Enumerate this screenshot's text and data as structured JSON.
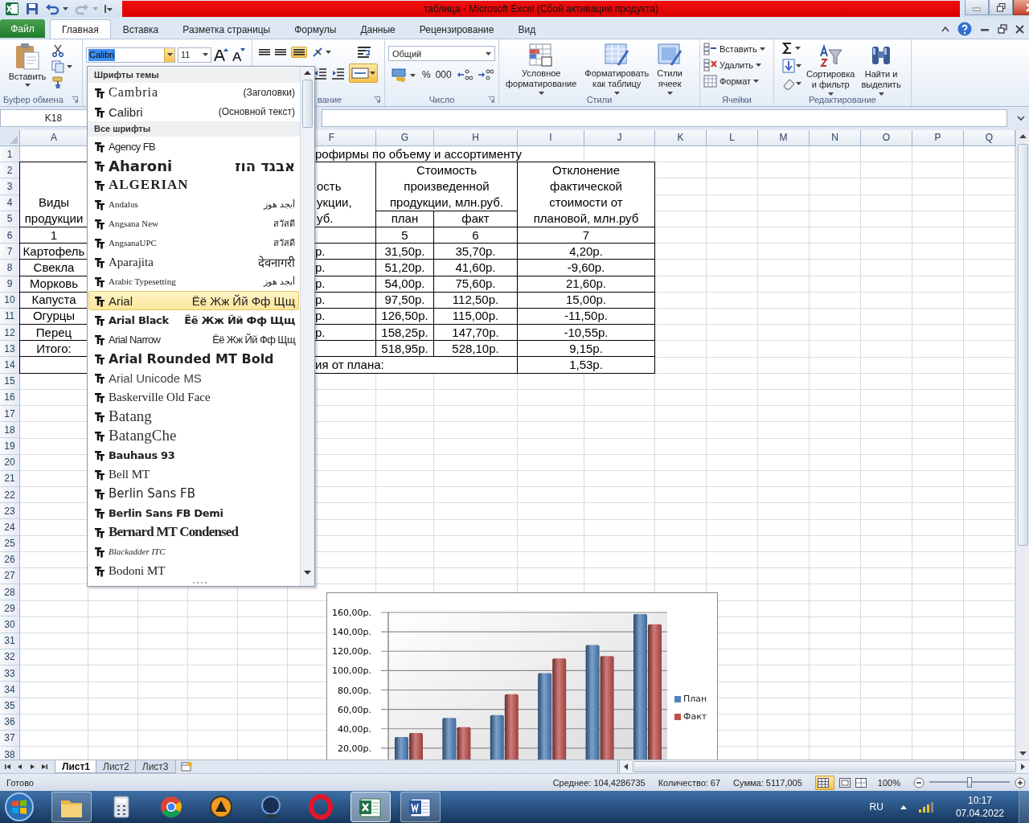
{
  "window": {
    "title": "таблица  -  Microsoft Excel (Сбой активации продукта)"
  },
  "ribbon_tabs": [
    {
      "label": "Файл",
      "kind": "file"
    },
    {
      "label": "Главная",
      "kind": "tab",
      "selected": true
    },
    {
      "label": "Вставка",
      "kind": "tab",
      "selected": false
    },
    {
      "label": "Разметка страницы",
      "kind": "tab",
      "selected": false
    },
    {
      "label": "Формулы",
      "kind": "tab",
      "selected": false
    },
    {
      "label": "Данные",
      "kind": "tab",
      "selected": false
    },
    {
      "label": "Рецензирование",
      "kind": "tab",
      "selected": false
    },
    {
      "label": "Вид",
      "kind": "tab",
      "selected": false
    }
  ],
  "clipboard": {
    "paste": "Вставить",
    "label": "Буфер обмена"
  },
  "font": {
    "name": "Calibri",
    "size": "11"
  },
  "alignment": {
    "label": "вание"
  },
  "number": {
    "format": "Общий",
    "percent": "%",
    "thousands": "000",
    "label": "Число"
  },
  "styles": {
    "buttons": [
      "Условное\nформатирование",
      "Форматировать\nкак таблицу",
      "Стили\nячеек"
    ],
    "label": "Стили"
  },
  "cells": {
    "buttons": [
      "Вставить",
      "Удалить",
      "Формат"
    ],
    "label": "Ячейки"
  },
  "editing": {
    "buttons": [
      "Сортировка\nи фильтр",
      "Найти и\nвыделить"
    ],
    "label": "Редактирование"
  },
  "name_box": "K18",
  "font_menu": {
    "sections": [
      {
        "title": "Шрифты темы",
        "items": [
          {
            "name": "Cambria",
            "note": "(Заголовки)",
            "kind": "serif-wide",
            "selected": false
          },
          {
            "name": "Calibri",
            "note": "(Основной текст)",
            "kind": "sans",
            "selected": false
          }
        ]
      },
      {
        "title": "Все шрифты",
        "items": [
          {
            "name": "Agency FB",
            "kind": "narrow",
            "selected": false
          },
          {
            "name": "Aharoni",
            "sample": "אבגד הוז",
            "kind": "heavy",
            "selected": false
          },
          {
            "name": "ALGERIAN",
            "kind": "caps",
            "selected": false
          },
          {
            "name": "Andalus",
            "sample": "أبجد هوز",
            "kind": "tiny-serif",
            "selected": false
          },
          {
            "name": "Angsana New",
            "sample": "สวัสดี",
            "kind": "tiny-serif",
            "selected": false
          },
          {
            "name": "AngsanaUPC",
            "sample": "สวัสดี",
            "kind": "tiny-serif",
            "selected": false
          },
          {
            "name": "Aparajita",
            "sample": "देवनागरी",
            "kind": "serif",
            "selected": false
          },
          {
            "name": "Arabic Typesetting",
            "sample": "أبجد هوز",
            "kind": "tiny-serif",
            "selected": false
          },
          {
            "name": "Arial",
            "sample": "Ёё Жж Йй Фф Щщ",
            "kind": "sans",
            "selected": true
          },
          {
            "name": "Arial Black",
            "sample": "Ёё Жж Йй Фф Щщ",
            "kind": "black",
            "selected": false
          },
          {
            "name": "Arial Narrow",
            "sample": "Ёё Жж Йй Фф Щщ",
            "kind": "narrow",
            "selected": false
          },
          {
            "name": "Arial Rounded MT Bold",
            "kind": "rounded",
            "selected": false
          },
          {
            "name": "Arial Unicode MS",
            "kind": "light",
            "selected": false
          },
          {
            "name": "Baskerville Old Face",
            "kind": "serif",
            "selected": false
          },
          {
            "name": "Batang",
            "kind": "serif-large",
            "selected": false
          },
          {
            "name": "BatangChe",
            "kind": "serif-large",
            "selected": false
          },
          {
            "name": "Bauhaus 93",
            "kind": "black",
            "selected": false
          },
          {
            "name": "Bell MT",
            "kind": "serif",
            "selected": false
          },
          {
            "name": "Berlin Sans FB",
            "kind": "sans-medium",
            "selected": false
          },
          {
            "name": "Berlin Sans FB Demi",
            "kind": "black",
            "selected": false
          },
          {
            "name": "Bernard MT Condensed",
            "kind": "condensed",
            "selected": false
          },
          {
            "name": "Blackadder ITC",
            "kind": "script",
            "selected": false
          },
          {
            "name": "Bodoni MT",
            "kind": "serif",
            "selected": false
          }
        ]
      }
    ]
  },
  "sheet": {
    "columns": [
      "A",
      null,
      null,
      null,
      null,
      "F",
      "G",
      "H",
      "I",
      "J",
      "K",
      "L",
      "M",
      "N",
      "O",
      "P",
      "Q"
    ],
    "rows": [
      {
        "header": "1",
        "cells": [
          null,
          null,
          null,
          null,
          null,
          {
            "kind": "title",
            "text": "рофирмы по объему и ассортименту"
          },
          {
            "kind": "merged-left"
          },
          {
            "kind": "merged-left"
          },
          {
            "kind": "merged-left"
          },
          {
            "kind": "merged-left"
          }
        ]
      },
      {
        "header": "2",
        "cells": [
          {
            "kind": "bottom",
            "text": "Виды\nпродукции"
          },
          null,
          null,
          null,
          null,
          {
            "kind": "cut-bottom",
            "text": "ость\nукции,\nуб."
          },
          {
            "kind": "value",
            "text": "Стоимость\nпроизведенной\nпродукции, млн.руб."
          },
          {
            "kind": "merged-left"
          },
          {
            "kind": "value",
            "text": "Отклонение\nфактической\nстоимости от\nплановой, млн.руб"
          },
          {
            "kind": "merged-left"
          }
        ]
      },
      {
        "header": "3",
        "cells": [
          {
            "kind": "merged-up"
          },
          null,
          null,
          null,
          null,
          {
            "kind": "merged-up"
          },
          {
            "kind": "merged-up"
          },
          {
            "kind": "merged-up"
          },
          {
            "kind": "merged-up"
          },
          {
            "kind": "merged-up"
          }
        ]
      },
      {
        "header": "4",
        "cells": [
          {
            "kind": "merged-up"
          },
          null,
          null,
          null,
          null,
          {
            "kind": "merged-up"
          },
          {
            "kind": "merged-up"
          },
          {
            "kind": "merged-up"
          },
          {
            "kind": "merged-up"
          },
          {
            "kind": "merged-up"
          }
        ]
      },
      {
        "header": "5",
        "cells": [
          {
            "kind": "merged-up"
          },
          null,
          null,
          null,
          null,
          {
            "kind": "merged-up"
          },
          {
            "kind": "value",
            "text": "план"
          },
          {
            "kind": "value",
            "text": "факт"
          },
          {
            "kind": "merged-up"
          },
          {
            "kind": "merged-up"
          }
        ]
      },
      {
        "header": "6",
        "cells": [
          {
            "kind": "value",
            "text": "1"
          },
          null,
          null,
          null,
          null,
          {
            "kind": "value"
          },
          {
            "kind": "value",
            "text": "5"
          },
          {
            "kind": "value",
            "text": "6"
          },
          {
            "kind": "value",
            "text": "7"
          },
          {
            "kind": "merged-left"
          }
        ]
      },
      {
        "header": "7",
        "cells": [
          {
            "kind": "value",
            "text": "Картофель"
          },
          null,
          null,
          null,
          null,
          {
            "kind": "cut",
            "text": "р."
          },
          {
            "kind": "value",
            "text": "31,50р."
          },
          {
            "kind": "value",
            "text": "35,70р."
          },
          {
            "kind": "value",
            "text": "4,20р."
          },
          {
            "kind": "merged-left"
          }
        ]
      },
      {
        "header": "8",
        "cells": [
          {
            "kind": "value",
            "text": "Свекла"
          },
          null,
          null,
          null,
          null,
          {
            "kind": "cut",
            "text": "р."
          },
          {
            "kind": "value",
            "text": "51,20р."
          },
          {
            "kind": "value",
            "text": "41,60р."
          },
          {
            "kind": "value",
            "text": "-9,60р."
          },
          {
            "kind": "merged-left"
          }
        ]
      },
      {
        "header": "9",
        "cells": [
          {
            "kind": "value",
            "text": "Морковь"
          },
          null,
          null,
          null,
          null,
          {
            "kind": "cut",
            "text": "р."
          },
          {
            "kind": "value",
            "text": "54,00р."
          },
          {
            "kind": "value",
            "text": "75,60р."
          },
          {
            "kind": "value",
            "text": "21,60р."
          },
          {
            "kind": "merged-left"
          }
        ]
      },
      {
        "header": "10",
        "cells": [
          {
            "kind": "value",
            "text": "Капуста"
          },
          null,
          null,
          null,
          null,
          {
            "kind": "cut",
            "text": "р."
          },
          {
            "kind": "value",
            "text": "97,50р."
          },
          {
            "kind": "value",
            "text": "112,50р."
          },
          {
            "kind": "value",
            "text": "15,00р."
          },
          {
            "kind": "merged-left"
          }
        ]
      },
      {
        "header": "11",
        "cells": [
          {
            "kind": "value",
            "text": "Огурцы"
          },
          null,
          null,
          null,
          null,
          {
            "kind": "cut",
            "text": "р."
          },
          {
            "kind": "value",
            "text": "126,50р."
          },
          {
            "kind": "value",
            "text": "115,00р."
          },
          {
            "kind": "value",
            "text": "-11,50р."
          },
          {
            "kind": "merged-left"
          }
        ]
      },
      {
        "header": "12",
        "cells": [
          {
            "kind": "value",
            "text": "Перец"
          },
          null,
          null,
          null,
          null,
          {
            "kind": "cut",
            "text": "р."
          },
          {
            "kind": "value",
            "text": "158,25р."
          },
          {
            "kind": "value",
            "text": "147,70р."
          },
          {
            "kind": "value",
            "text": "-10,55р."
          },
          {
            "kind": "merged-left"
          }
        ]
      },
      {
        "header": "13",
        "cells": [
          {
            "kind": "value",
            "text": "Итого:"
          },
          null,
          null,
          null,
          null,
          {
            "kind": "value"
          },
          {
            "kind": "value",
            "text": "518,95р."
          },
          {
            "kind": "value",
            "text": "528,10р."
          },
          {
            "kind": "value",
            "text": "9,15р."
          },
          {
            "kind": "merged-left"
          }
        ]
      },
      {
        "header": "14",
        "cells": [
          {
            "kind": "value"
          },
          null,
          null,
          null,
          null,
          {
            "kind": "cut",
            "text": "ия от плана:"
          },
          {
            "kind": "merged-left"
          },
          {
            "kind": "merged-left"
          },
          {
            "kind": "value",
            "text": "1,53р."
          },
          {
            "kind": "merged-left"
          }
        ]
      },
      {
        "header": "15"
      },
      {
        "header": "16"
      },
      {
        "header": "17"
      },
      {
        "header": "18"
      },
      {
        "header": "19"
      },
      {
        "header": "20"
      },
      {
        "header": "21"
      },
      {
        "header": "22"
      },
      {
        "header": "23"
      },
      {
        "header": "24"
      },
      {
        "header": "25"
      },
      {
        "header": "26"
      },
      {
        "header": "27"
      },
      {
        "header": "28"
      },
      {
        "header": "29"
      },
      {
        "header": "30"
      },
      {
        "header": "31"
      },
      {
        "header": "32"
      },
      {
        "header": "33"
      },
      {
        "header": "34"
      },
      {
        "header": "35"
      },
      {
        "header": "36"
      },
      {
        "header": "37"
      },
      {
        "header": "38"
      }
    ],
    "chart_data": {
      "type": "bar",
      "grid": true,
      "legend": true,
      "ylim": [
        0,
        160
      ],
      "yticks": [
        {
          "value": 20,
          "label": "20,00р."
        },
        {
          "value": 40,
          "label": "40,00р."
        },
        {
          "value": 60,
          "label": "60,00р."
        },
        {
          "value": 80,
          "label": "80,00р."
        },
        {
          "value": 100,
          "label": "100,00р."
        },
        {
          "value": 120,
          "label": "120,00р."
        },
        {
          "value": 140,
          "label": "140,00р."
        },
        {
          "value": 160,
          "label": "160,00р."
        }
      ],
      "series": [
        {
          "name": "План",
          "color": "#4f81bd",
          "values": [
            31.5,
            51.2,
            54,
            97.5,
            126.5,
            158.25
          ]
        },
        {
          "name": "Факт",
          "color": "#c0504d",
          "values": [
            35.7,
            41.6,
            75.6,
            112.5,
            115,
            147.7
          ]
        }
      ]
    }
  },
  "sheet_tabs": [
    {
      "label": "Лист1",
      "selected": true
    },
    {
      "label": "Лист2",
      "selected": false
    },
    {
      "label": "Лист3",
      "selected": false
    }
  ],
  "status_bar": {
    "mode": "Готово",
    "average": "Среднее: 104,4286735",
    "count": "Количество: 67",
    "sum": "Сумма: 5117,005",
    "zoom": "100%",
    "zoom_slider": {
      "level": 0.5
    }
  },
  "taskbar": {
    "apps": [
      {
        "kind": "folder",
        "running": true,
        "selected": false
      },
      {
        "kind": "calculator",
        "running": false,
        "selected": false
      },
      {
        "kind": "chrome",
        "running": false,
        "selected": false
      },
      {
        "kind": "aimp",
        "running": false,
        "selected": false
      },
      {
        "kind": "kmp",
        "running": false,
        "selected": false
      },
      {
        "kind": "opera",
        "running": false,
        "selected": false
      },
      {
        "kind": "excel",
        "running": true,
        "selected": true
      },
      {
        "kind": "word",
        "running": true,
        "selected": false
      }
    ],
    "language": "RU",
    "time": "10:17",
    "date": "07.04.2022"
  }
}
